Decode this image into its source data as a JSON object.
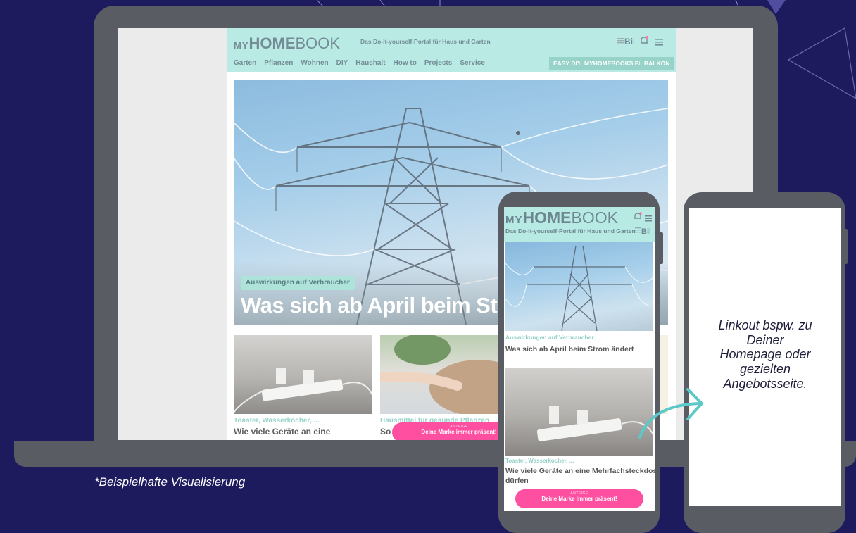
{
  "site": {
    "logo_my": "MY",
    "logo_home": "HOME",
    "logo_book": "BOOK",
    "tagline": "Das Do-it-yourself-Portal für Haus und Garten",
    "nav": [
      "Garten",
      "Pflanzen",
      "Wohnen",
      "DIY",
      "Haushalt",
      "How to",
      "Projects",
      "Service"
    ],
    "pills": [
      "EASY DIY",
      "MYHOMEBOOKS BESTE",
      "BALKON"
    ],
    "hero_tag": "Auswirkungen auf Verbraucher",
    "hero_title": "Was sich ab April beim Strom än",
    "cards": [
      {
        "category": "Toaster, Wasserkocher, ...",
        "title": "Wie viele Geräte an eine"
      },
      {
        "category": "Hausmittel für gesunde Pflanzen",
        "title": "So"
      }
    ],
    "ad_label": "ANZEIGE",
    "ad_text": "Deine Marke immer präsent!"
  },
  "phone": {
    "hero_tag": "Auswirkungen auf Verbraucher",
    "hero_title": "Was sich ab April beim Strom ändert",
    "card_category": "Toaster, Wasserkocher, ...",
    "card_title_1": "Wie viele Geräte an eine Mehrfachsteckdose",
    "card_title_2": "dürfen",
    "ad_label": "ANZEIGE",
    "ad_text": "Deine Marke immer präsent!"
  },
  "linkout": {
    "line1": "Linkout bspw. zu",
    "line2": "Deiner",
    "line3": "Homepage oder",
    "line4": "gezielten",
    "line5": "Angebotsseite."
  },
  "caption": "*Beispielhafte Visualisierung",
  "colors": {
    "background": "#1d1a5e",
    "device": "#5a5c64",
    "header_mint": "#a6e6dd",
    "accent_teal": "#7cc7bb",
    "ad_pink": "#ff4fa0",
    "arrow": "#5cc8c8"
  },
  "icons": [
    "bell-icon",
    "menu-icon",
    "bild-logo",
    "arrow-icon"
  ]
}
